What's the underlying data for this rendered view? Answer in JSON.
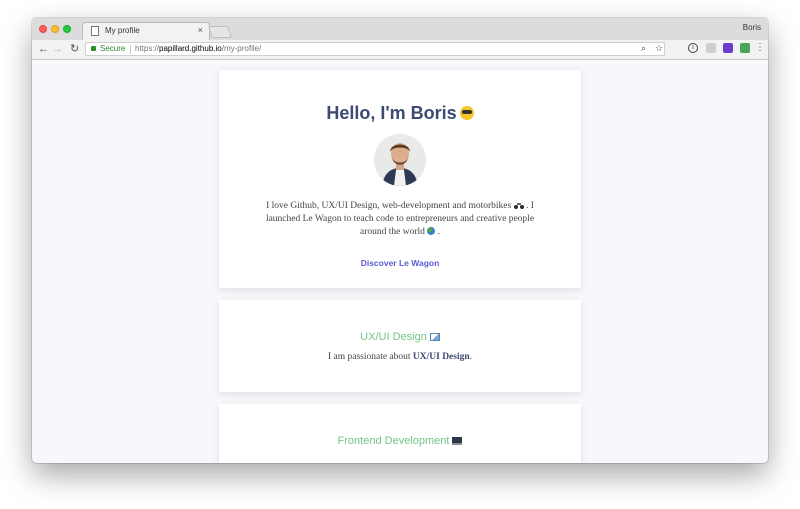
{
  "browser": {
    "tab_title": "My profile",
    "tab_close": "×",
    "user_name": "Boris",
    "secure_label": "Secure",
    "url_scheme": "https://",
    "url_host": "papillard.github.io",
    "url_path": "/my-profile/"
  },
  "profile": {
    "greeting": "Hello, I'm Boris",
    "bio_line1": "I love Github, UX/UI Design, web-development and motorbikes",
    "bio_line1_end": ". I",
    "bio_line2": "launched Le Wagon to teach code to entrepreneurs and creative people",
    "bio_line3": "around the world",
    "bio_line3_end": ".",
    "link": "Discover Le Wagon"
  },
  "sections": [
    {
      "title": "UX/UI Design",
      "text_prefix": "I am passionate about ",
      "text_bold": "UX/UI Design",
      "text_suffix": "."
    },
    {
      "title": "Frontend Development"
    }
  ],
  "colors": {
    "heading": "#3d4a72",
    "section_title": "#74c487",
    "link": "#5b5bd6",
    "background": "#f6f8fc"
  }
}
